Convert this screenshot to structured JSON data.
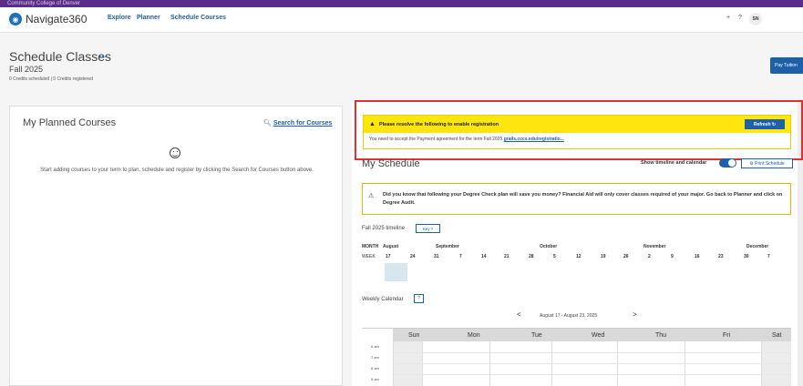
{
  "top_strip": {
    "text": "Community College of Denver"
  },
  "nav": {
    "brand": "Navigate360",
    "links": [
      "Explore",
      "Planner",
      "Schedule Courses"
    ],
    "right_plus": "+",
    "right_help": "?",
    "avatar": "SN"
  },
  "page": {
    "title": "Schedule Classes",
    "more": "...",
    "term": "Fall 2025",
    "credits": "0 Credits scheduled | 0 Credits registered",
    "pay_button": "Pay Tuition"
  },
  "planned": {
    "title": "My Planned Courses",
    "search_link": "Search for Courses",
    "empty_message": "Start adding courses to your term to plan, schedule and register by clicking the Search for Courses button above."
  },
  "alert": {
    "title": "Please resolve the following to enable registration",
    "refresh_label": "Refresh",
    "body": "You need to accept the Payment agreement for the term Fall 2025",
    "link": "grails.cccs.edu/registratio..."
  },
  "schedule": {
    "title": "My Schedule",
    "toggle_label": "Show timeline and calendar",
    "toggle_on": true,
    "print_label": "Print Schedule",
    "tip": "Did you know that following your Degree Check plan will save you money? Financial Aid will only cover classes required of your major. Go back to Planner and click on Degree Audit."
  },
  "timeline": {
    "label": "Fall 2025 timeline",
    "key_label": "Key",
    "month_label": "MONTH",
    "week_label": "WEEK",
    "months": [
      "August",
      "September",
      "October",
      "November",
      "December"
    ],
    "weeks": [
      "17",
      "24",
      "31",
      "7",
      "14",
      "21",
      "28",
      "5",
      "12",
      "19",
      "26",
      "2",
      "9",
      "16",
      "23",
      "30",
      "7"
    ]
  },
  "weekly": {
    "label": "Weekly Calendar",
    "help": "?",
    "range": "August 17 - August 23, 2025",
    "prev": "<",
    "next": ">",
    "days": [
      "Sun",
      "Mon",
      "Tue",
      "Wed",
      "Thu",
      "Fri",
      "Sat"
    ],
    "hours": [
      "6 am",
      "7 am",
      "8 am",
      "9 am"
    ]
  },
  "colors": {
    "purple": "#5b2d8a",
    "primary": "#1d5fa8",
    "alert_yellow": "#fde50d",
    "highlight_red": "#e0312f"
  }
}
